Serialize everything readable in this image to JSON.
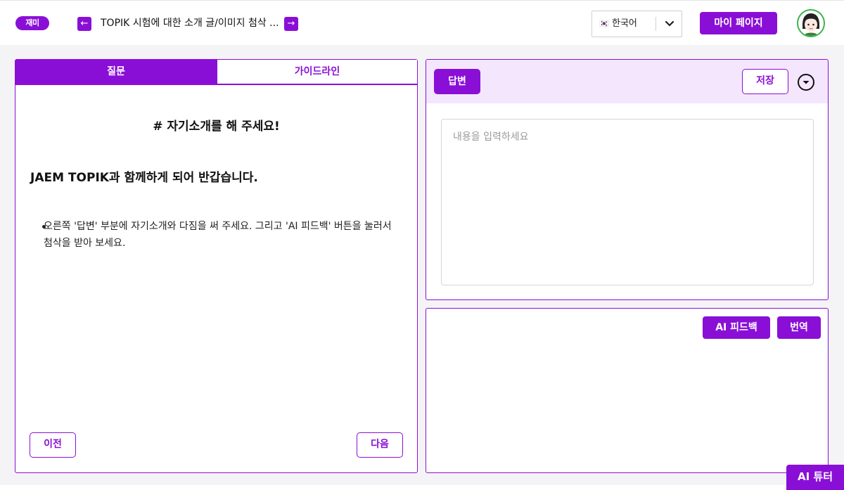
{
  "header": {
    "logo_text": "재미",
    "prev_arrow": "←",
    "next_arrow": "→",
    "title": "TOPIK 시험에 대한 소개 글/이미지 첨삭 ...",
    "language": {
      "flag": "🇰🇷",
      "label": "한국어"
    },
    "mypage_label": "마이 페이지"
  },
  "question_panel": {
    "tabs": [
      {
        "label": "질문",
        "active": true
      },
      {
        "label": "가이드라인",
        "active": false
      }
    ],
    "title": "# 자기소개를 해 주세요!",
    "greeting": "JAEM TOPIK과 함께하게 되어 반갑습니다.",
    "bullets": [
      "오른쪽 '답변' 부분에 자기소개와 다짐을 써 주세요. 그리고 'AI 피드백' 버튼을 눌러서 첨삭을 받아 보세요."
    ],
    "prev_label": "이전",
    "next_label": "다음"
  },
  "answer_panel": {
    "tag_label": "답변",
    "save_label": "저장",
    "input_value": "",
    "placeholder": "내용을 입력하세요"
  },
  "feedback_panel": {
    "ai_feedback_label": "AI 피드백",
    "translate_label": "번역"
  },
  "ai_tutor_label": "AI 튜터",
  "colors": {
    "accent": "#8a0fd6",
    "accent_light": "#f4e6fd",
    "avatar_ring": "#3bb54a"
  },
  "icons": {
    "collapse": "chevron-down-circle-icon",
    "language_dropdown": "chevron-down-icon",
    "avatar": "user-avatar-icon"
  }
}
